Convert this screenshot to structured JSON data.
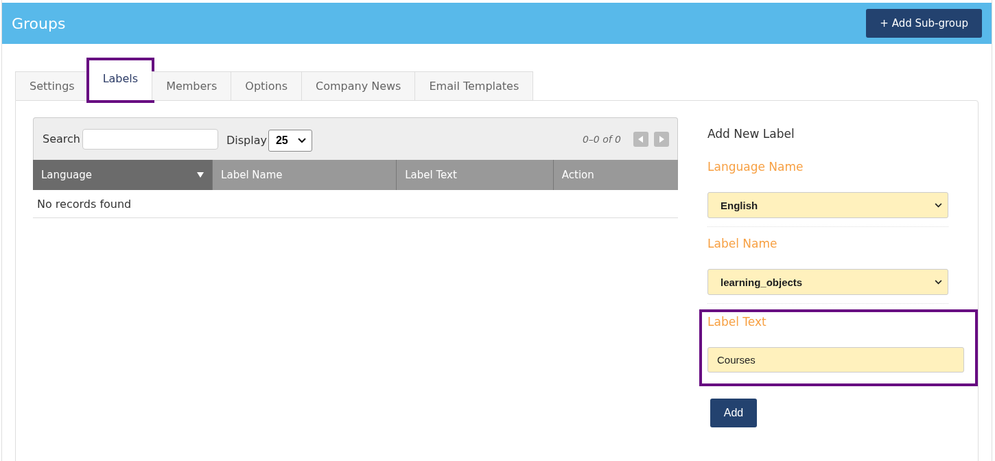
{
  "header": {
    "title": "Groups",
    "add_button": "+ Add Sub-group"
  },
  "tabs": [
    {
      "label": "Settings",
      "selected": false,
      "highlighted": false
    },
    {
      "label": "Labels",
      "selected": true,
      "highlighted": true
    },
    {
      "label": "Members",
      "selected": false,
      "highlighted": false
    },
    {
      "label": "Options",
      "selected": false,
      "highlighted": false
    },
    {
      "label": "Company News",
      "selected": false,
      "highlighted": false
    },
    {
      "label": "Email Templates",
      "selected": false,
      "highlighted": false
    }
  ],
  "table": {
    "search_label": "Search",
    "display_label": "Display",
    "display_value": "25",
    "pagination": "0–0 of 0",
    "columns": [
      {
        "label": "Language",
        "sorted": true
      },
      {
        "label": "Label Name",
        "sorted": false
      },
      {
        "label": "Label Text",
        "sorted": false
      },
      {
        "label": "Action",
        "sorted": false
      }
    ],
    "empty_message": "No records found"
  },
  "form": {
    "title": "Add New Label",
    "fields": [
      {
        "kind": "select",
        "label": "Language Name",
        "value": "English",
        "highlighted": false
      },
      {
        "kind": "select",
        "label": "Label Name",
        "value": "learning_objects",
        "highlighted": false
      },
      {
        "kind": "text",
        "label": "Label Text",
        "value": "Courses",
        "highlighted": true
      }
    ],
    "submit": "Add"
  }
}
